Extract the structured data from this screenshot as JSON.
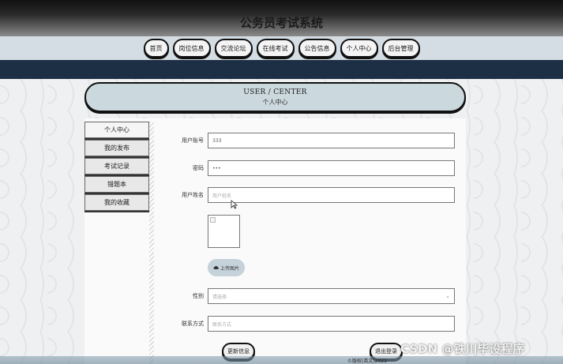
{
  "header": {
    "site_title": "公务员考试系统"
  },
  "nav": {
    "items": [
      {
        "label": "首页"
      },
      {
        "label": "岗位信息"
      },
      {
        "label": "交流论坛"
      },
      {
        "label": "在线考试"
      },
      {
        "label": "公告信息"
      },
      {
        "label": "个人中心"
      },
      {
        "label": "后台管理"
      }
    ]
  },
  "banner": {
    "title_en": "USER / CENTER",
    "title_zh": "个人中心"
  },
  "sidebar": {
    "items": [
      {
        "label": "个人中心"
      },
      {
        "label": "我的发布"
      },
      {
        "label": "考试记录"
      },
      {
        "label": "错题本"
      },
      {
        "label": "我的收藏"
      }
    ]
  },
  "form": {
    "account": {
      "label": "用户账号",
      "value": "333"
    },
    "password": {
      "label": "密码",
      "value": "•••"
    },
    "name": {
      "label": "用户姓名",
      "placeholder": "用户姓名"
    },
    "upload": {
      "label": "上传图片"
    },
    "gender": {
      "label": "性别",
      "placeholder": "请选择"
    },
    "contact": {
      "label": "联系方式",
      "placeholder": "联系方式"
    }
  },
  "actions": {
    "update": "更新信息",
    "logout": "退出登录"
  },
  "footer": {
    "text": "©版权(英文)2021"
  },
  "watermark": "CSDN @铁川毕设程序"
}
